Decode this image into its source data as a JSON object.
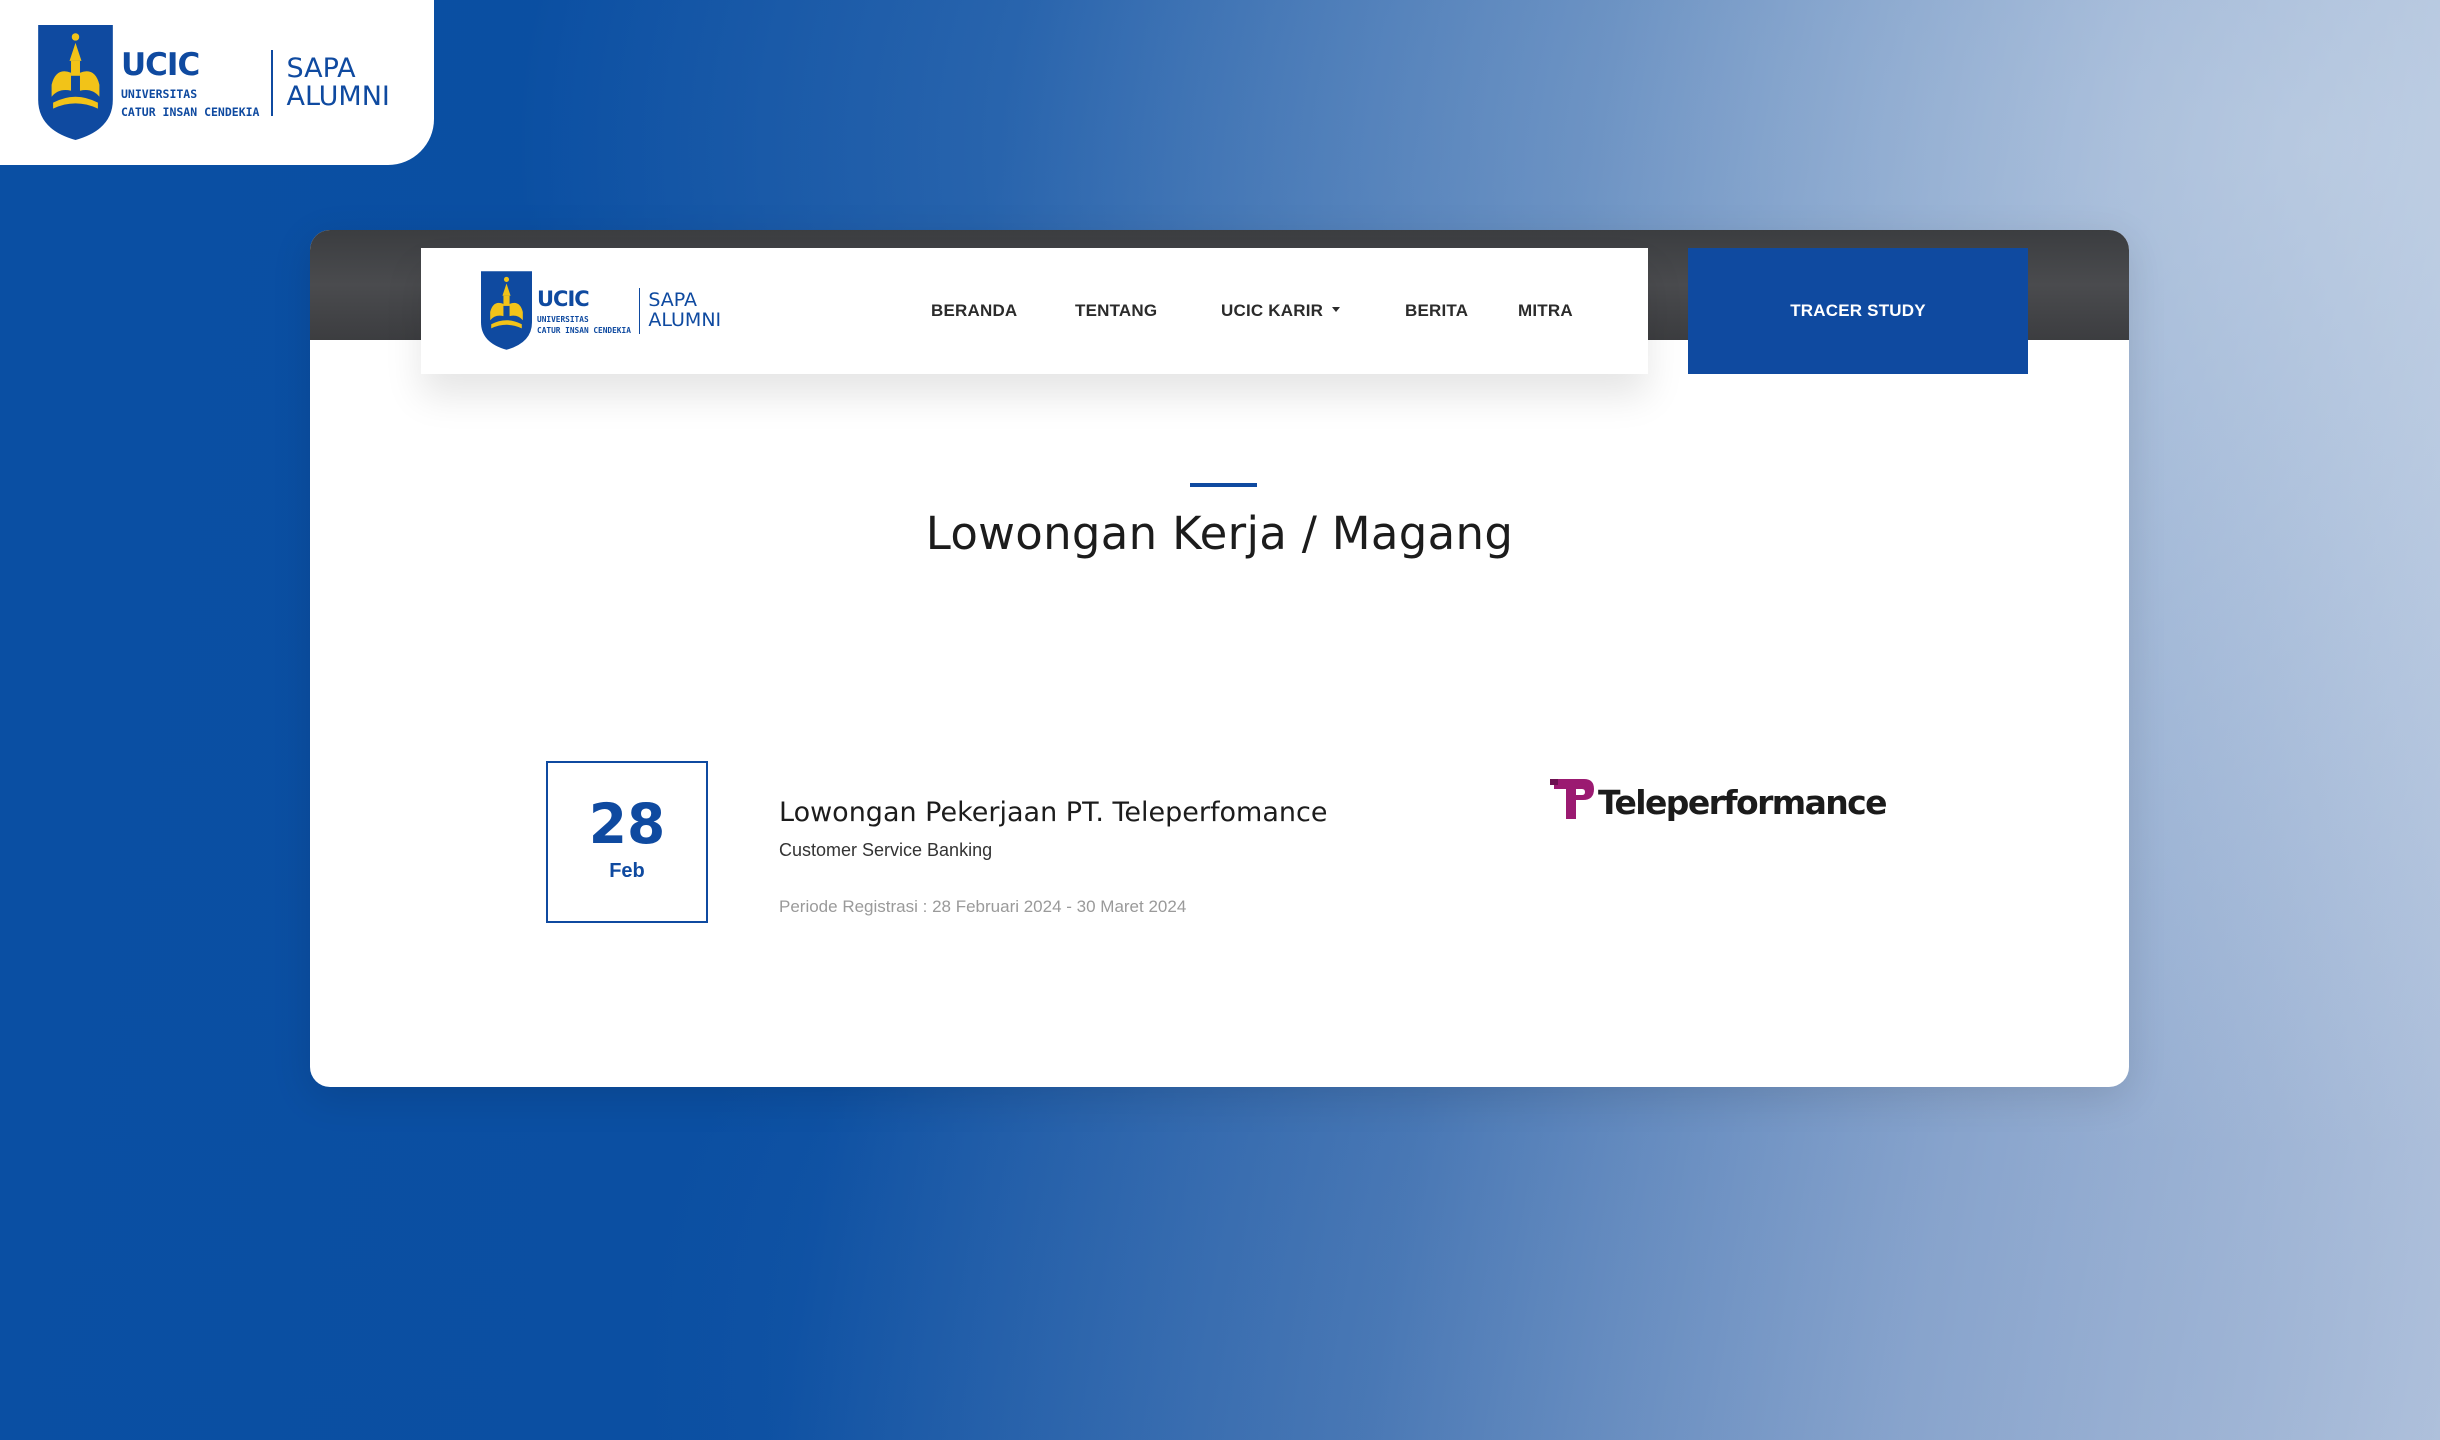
{
  "brand": {
    "wordmark": "UCIC",
    "sub_line1": "UNIVERSITAS",
    "sub_line2": "CATUR INSAN CENDEKIA",
    "product_line1": "SAPA",
    "product_line2": "ALUMNI"
  },
  "nav": {
    "items": [
      {
        "label": "BERANDA"
      },
      {
        "label": "TENTANG"
      },
      {
        "label": "UCIC KARIR"
      },
      {
        "label": "BERITA"
      },
      {
        "label": "MITRA"
      }
    ],
    "cta_label": "TRACER STUDY"
  },
  "section": {
    "title": "Lowongan Kerja / Magang"
  },
  "jobs": [
    {
      "day": "28",
      "month": "Feb",
      "title": "Lowongan Pekerjaan PT. Teleperfomance",
      "position": "Customer Service Banking",
      "period": "Periode Registrasi : 28 Februari 2024 - 30 Maret 2024",
      "company": "Teleperformance"
    }
  ],
  "colors": {
    "brand_blue": "#0f4aa0",
    "crest_gold": "#f2c318",
    "teleperformance_magenta": "#9b1a71"
  },
  "icons": {
    "crest": "university-crest-icon",
    "caret": "caret-down-icon",
    "company_mark": "teleperformance-mark-icon"
  }
}
